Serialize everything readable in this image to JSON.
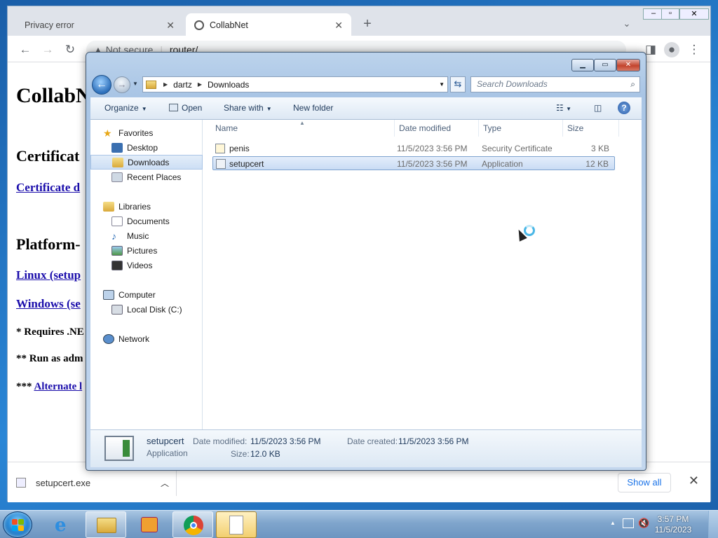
{
  "chrome": {
    "tabs": [
      {
        "label": "Privacy error",
        "active": false
      },
      {
        "label": "CollabNet",
        "active": true
      }
    ],
    "new_tab": "+",
    "address": {
      "security": "Not secure",
      "url": "router/"
    },
    "page": {
      "title": "CollabN",
      "cert_heading": "Certificat",
      "cert_link": "Certificate d",
      "platform_heading": "Platform-",
      "linux_link": "Linux (setup",
      "windows_link": "Windows (se",
      "note1": "* Requires .NE",
      "note2": "** Run as adm",
      "note3_prefix": "***",
      "note3_link": "Alternate l"
    },
    "download": {
      "filename": "setupcert.exe",
      "show_all": "Show all"
    }
  },
  "explorer": {
    "breadcrumb": [
      "dartz",
      "Downloads"
    ],
    "search_placeholder": "Search Downloads",
    "commands": {
      "organize": "Organize",
      "open": "Open",
      "share_with": "Share with",
      "new_folder": "New folder"
    },
    "nav": {
      "favorites": "Favorites",
      "desktop": "Desktop",
      "downloads": "Downloads",
      "recent_places": "Recent Places",
      "libraries": "Libraries",
      "documents": "Documents",
      "music": "Music",
      "pictures": "Pictures",
      "videos": "Videos",
      "computer": "Computer",
      "local_disk": "Local Disk (C:)",
      "network": "Network"
    },
    "columns": {
      "name": "Name",
      "date_modified": "Date modified",
      "type": "Type",
      "size": "Size"
    },
    "files": [
      {
        "name": "penis",
        "date": "11/5/2023 3:56 PM",
        "type": "Security Certificate",
        "size": "3 KB"
      },
      {
        "name": "setupcert",
        "date": "11/5/2023 3:56 PM",
        "type": "Application",
        "size": "12 KB"
      }
    ],
    "details": {
      "name": "setupcert",
      "type": "Application",
      "date_modified_label": "Date modified:",
      "date_modified": "11/5/2023 3:56 PM",
      "date_created_label": "Date created:",
      "date_created": "11/5/2023 3:56 PM",
      "size_label": "Size:",
      "size": "12.0 KB"
    }
  },
  "taskbar": {
    "time": "3:57 PM",
    "date": "11/5/2023"
  }
}
